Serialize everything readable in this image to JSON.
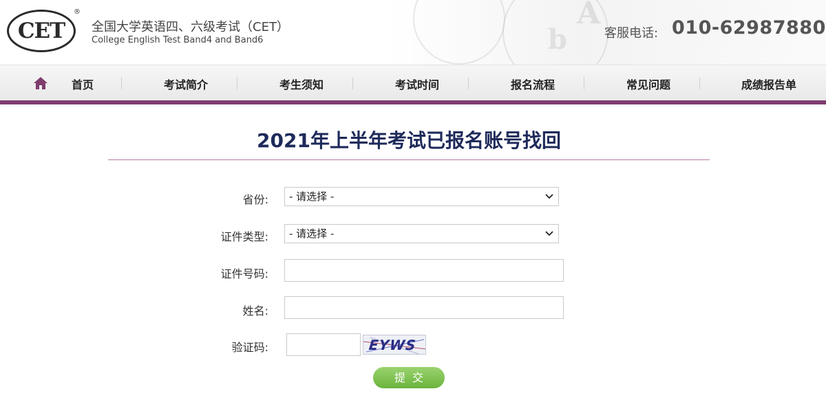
{
  "header": {
    "logo_text": "CET",
    "logo_reg": "®",
    "title_cn": "全国大学英语四、六级考试（CET）",
    "title_en": "College English Test Band4 and Band6",
    "hotline_label": "客服电话:",
    "hotline_number": "010-62987880"
  },
  "nav": {
    "home_icon": "home-icon",
    "items": [
      {
        "label": "首页"
      },
      {
        "label": "考试简介"
      },
      {
        "label": "考生须知"
      },
      {
        "label": "考试时间"
      },
      {
        "label": "报名流程"
      },
      {
        "label": "常见问题"
      },
      {
        "label": "成绩报告单"
      }
    ]
  },
  "main": {
    "title": "2021年上半年考试已报名账号找回",
    "form": {
      "province_label": "省份:",
      "province_value": "- 请选择 -",
      "id_type_label": "证件类型:",
      "id_type_value": "- 请选择 -",
      "id_number_label": "证件号码:",
      "id_number_value": "",
      "name_label": "姓名:",
      "name_value": "",
      "captcha_label": "验证码:",
      "captcha_value": "",
      "captcha_image_text": "EYWS",
      "submit_label": "提交"
    }
  },
  "colors": {
    "accent": "#7e3d6e",
    "title": "#1e2a5a",
    "button": "#7fc24f"
  }
}
